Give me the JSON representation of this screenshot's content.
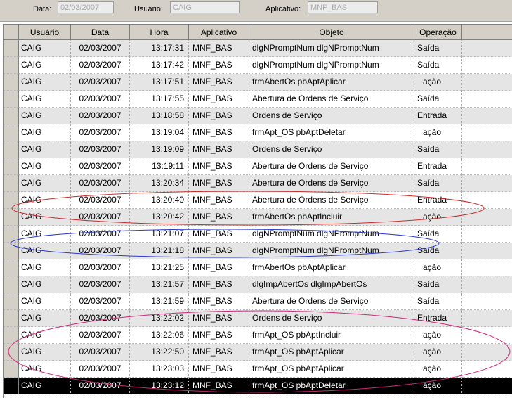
{
  "filters": {
    "data_label": "Data:",
    "data_value": "02/03/2007",
    "usuario_label": "Usuário:",
    "usuario_value": "CAIG",
    "aplicativo_label": "Aplicativo:",
    "aplicativo_value": "MNF_BAS"
  },
  "columns": [
    "Usuário",
    "Data",
    "Hora",
    "Aplicativo",
    "Objeto",
    "Operação"
  ],
  "rows": [
    {
      "usuario": "CAIG",
      "data": "02/03/2007",
      "hora": "13:17:31",
      "aplicativo": "MNF_BAS",
      "objeto": "dlgNPromptNum dlgNPromptNum",
      "operacao": "Saída"
    },
    {
      "usuario": "CAIG",
      "data": "02/03/2007",
      "hora": "13:17:42",
      "aplicativo": "MNF_BAS",
      "objeto": "dlgNPromptNum dlgNPromptNum",
      "operacao": "Saída"
    },
    {
      "usuario": "CAIG",
      "data": "02/03/2007",
      "hora": "13:17:51",
      "aplicativo": "MNF_BAS",
      "objeto": "frmAbertOs pbAptAplicar",
      "operacao": "ação"
    },
    {
      "usuario": "CAIG",
      "data": "02/03/2007",
      "hora": "13:17:55",
      "aplicativo": "MNF_BAS",
      "objeto": "Abertura de Ordens de Serviço",
      "operacao": "Saída"
    },
    {
      "usuario": "CAIG",
      "data": "02/03/2007",
      "hora": "13:18:58",
      "aplicativo": "MNF_BAS",
      "objeto": "Ordens de Serviço",
      "operacao": "Entrada"
    },
    {
      "usuario": "CAIG",
      "data": "02/03/2007",
      "hora": "13:19:04",
      "aplicativo": "MNF_BAS",
      "objeto": "frmApt_OS pbAptDeletar",
      "operacao": "ação"
    },
    {
      "usuario": "CAIG",
      "data": "02/03/2007",
      "hora": "13:19:09",
      "aplicativo": "MNF_BAS",
      "objeto": "Ordens de Serviço",
      "operacao": "Saída"
    },
    {
      "usuario": "CAIG",
      "data": "02/03/2007",
      "hora": "13:19:11",
      "aplicativo": "MNF_BAS",
      "objeto": "Abertura de Ordens de Serviço",
      "operacao": "Entrada"
    },
    {
      "usuario": "CAIG",
      "data": "02/03/2007",
      "hora": "13:20:34",
      "aplicativo": "MNF_BAS",
      "objeto": "Abertura de Ordens de Serviço",
      "operacao": "Saída"
    },
    {
      "usuario": "CAIG",
      "data": "02/03/2007",
      "hora": "13:20:40",
      "aplicativo": "MNF_BAS",
      "objeto": "Abertura de Ordens de Serviço",
      "operacao": "Entrada"
    },
    {
      "usuario": "CAIG",
      "data": "02/03/2007",
      "hora": "13:20:42",
      "aplicativo": "MNF_BAS",
      "objeto": "frmAbertOs pbAptIncluir",
      "operacao": "ação"
    },
    {
      "usuario": "CAIG",
      "data": "02/03/2007",
      "hora": "13:21:07",
      "aplicativo": "MNF_BAS",
      "objeto": "dlgNPromptNum dlgNPromptNum",
      "operacao": "Saída"
    },
    {
      "usuario": "CAIG",
      "data": "02/03/2007",
      "hora": "13:21:18",
      "aplicativo": "MNF_BAS",
      "objeto": "dlgNPromptNum dlgNPromptNum",
      "operacao": "Saída"
    },
    {
      "usuario": "CAIG",
      "data": "02/03/2007",
      "hora": "13:21:25",
      "aplicativo": "MNF_BAS",
      "objeto": "frmAbertOs pbAptAplicar",
      "operacao": "ação"
    },
    {
      "usuario": "CAIG",
      "data": "02/03/2007",
      "hora": "13:21:57",
      "aplicativo": "MNF_BAS",
      "objeto": "dlgImpAbertOs dlgImpAbertOs",
      "operacao": "Saída"
    },
    {
      "usuario": "CAIG",
      "data": "02/03/2007",
      "hora": "13:21:59",
      "aplicativo": "MNF_BAS",
      "objeto": "Abertura de Ordens de Serviço",
      "operacao": "Saída"
    },
    {
      "usuario": "CAIG",
      "data": "02/03/2007",
      "hora": "13:22:02",
      "aplicativo": "MNF_BAS",
      "objeto": "Ordens de Serviço",
      "operacao": "Entrada"
    },
    {
      "usuario": "CAIG",
      "data": "02/03/2007",
      "hora": "13:22:06",
      "aplicativo": "MNF_BAS",
      "objeto": "frmApt_OS pbAptIncluir",
      "operacao": "ação"
    },
    {
      "usuario": "CAIG",
      "data": "02/03/2007",
      "hora": "13:22:50",
      "aplicativo": "MNF_BAS",
      "objeto": "frmApt_OS pbAptAplicar",
      "operacao": "ação"
    },
    {
      "usuario": "CAIG",
      "data": "02/03/2007",
      "hora": "13:23:03",
      "aplicativo": "MNF_BAS",
      "objeto": "frmApt_OS pbAptAplicar",
      "operacao": "ação"
    },
    {
      "usuario": "CAIG",
      "data": "02/03/2007",
      "hora": "13:23:12",
      "aplicativo": "MNF_BAS",
      "objeto": "frmApt_OS pbAptDeletar",
      "operacao": "ação"
    }
  ],
  "selected_row": 20,
  "colors": {
    "header_bg": "#d4d0c8",
    "stripe_bg": "#e5e5e5",
    "selected_bg": "#000000",
    "annotation_red": "#cc2a2a",
    "annotation_blue": "#2a3ad0",
    "annotation_magenta": "#d0287a"
  }
}
